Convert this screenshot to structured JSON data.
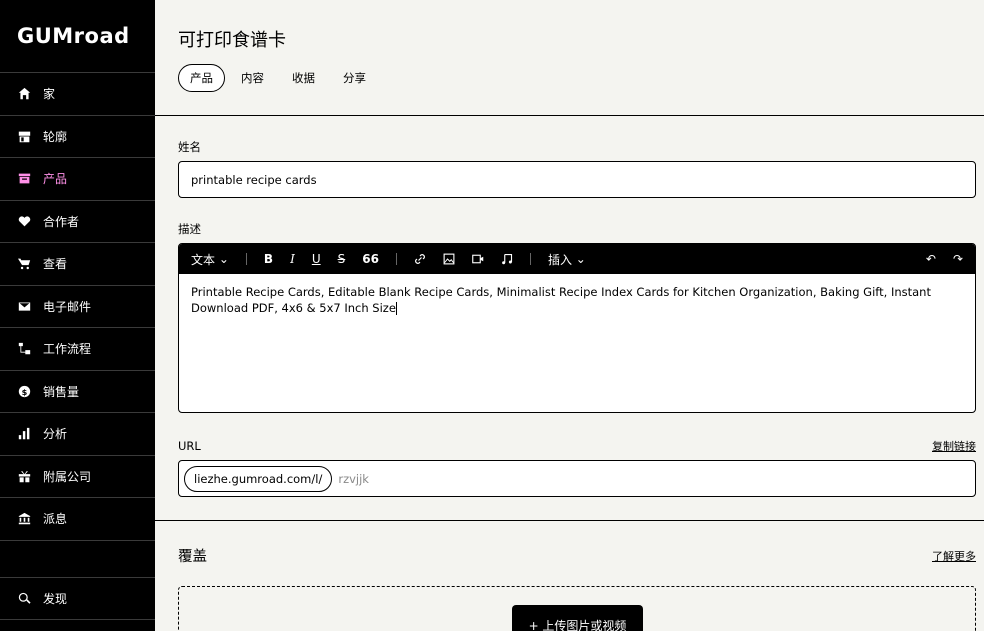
{
  "sidebar": {
    "logo": "GUMroad",
    "items": [
      {
        "label": "家",
        "icon": "home-icon"
      },
      {
        "label": "轮廓",
        "icon": "store-icon"
      },
      {
        "label": "产品",
        "icon": "archive-icon",
        "active": true
      },
      {
        "label": "合作者",
        "icon": "handshake-icon"
      },
      {
        "label": "查看",
        "icon": "cart-icon"
      },
      {
        "label": "电子邮件",
        "icon": "mail-icon"
      },
      {
        "label": "工作流程",
        "icon": "workflow-icon"
      },
      {
        "label": "销售量",
        "icon": "dollar-icon"
      },
      {
        "label": "分析",
        "icon": "bar-chart-icon"
      },
      {
        "label": "附属公司",
        "icon": "gift-icon"
      },
      {
        "label": "派息",
        "icon": "bank-icon"
      }
    ],
    "discover": {
      "label": "发现",
      "icon": "search-icon"
    },
    "accent_color": "#ff90e8"
  },
  "header": {
    "title": "可打印食谱卡",
    "tabs": [
      "产品",
      "内容",
      "收据",
      "分享"
    ],
    "active_tab": "产品"
  },
  "form": {
    "name_label": "姓名",
    "name_value": "printable recipe cards",
    "description_label": "描述",
    "toolbar": {
      "text_style": "文本",
      "bold": "B",
      "italic": "I",
      "underline": "U",
      "strike": "S",
      "quote": "66",
      "insert": "插入"
    },
    "description_value": "Printable Recipe Cards, Editable Blank Recipe Cards, Minimalist Recipe Index Cards for Kitchen Organization, Baking Gift, Instant Download PDF, 4x6 & 5x7 Inch Size",
    "url_label": "URL",
    "copy_link": "复制链接",
    "url_prefix": "liezhe.gumroad.com/l/",
    "url_slug": "rzvjjk"
  },
  "cover": {
    "title": "覆盖",
    "learn_more": "了解更多",
    "upload_label": "+ 上传图片或视频"
  }
}
